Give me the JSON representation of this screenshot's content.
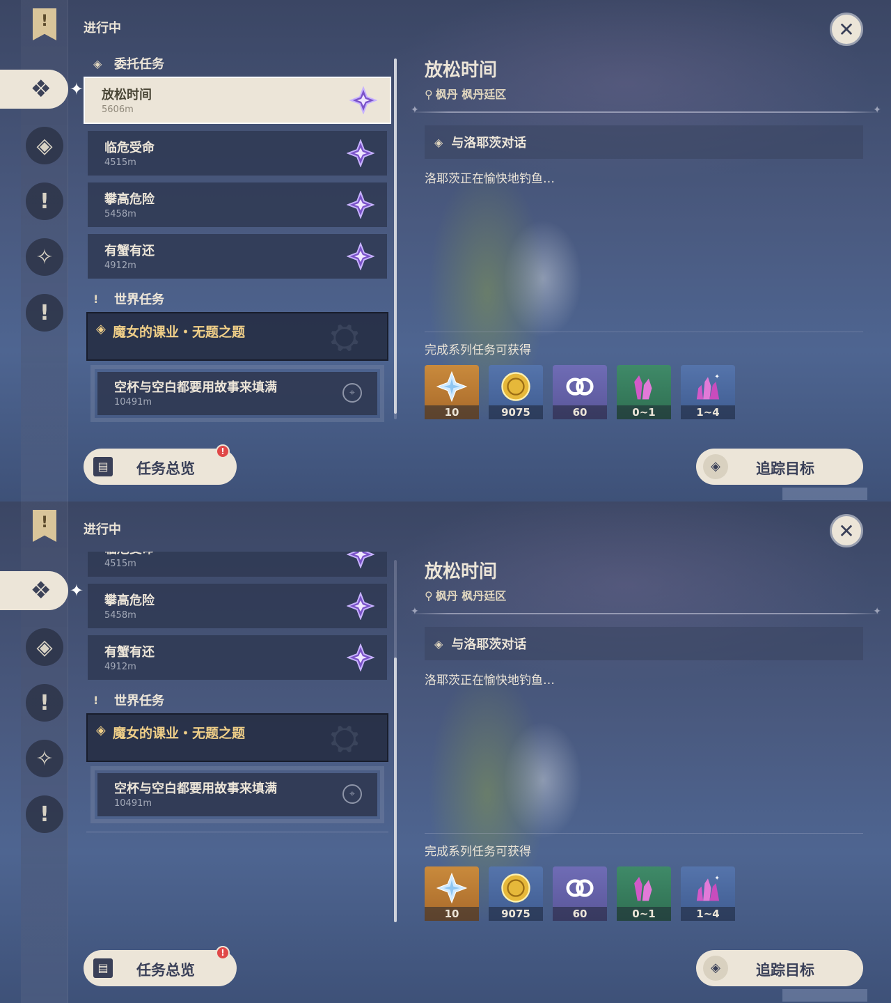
{
  "header": {
    "section_label": "进行中",
    "close_icon": "close-icon"
  },
  "rail": {
    "bookmark_glyph": "!",
    "active_icon": "commission-icon",
    "icons": [
      "archon-quest-icon",
      "story-quest-icon",
      "domain-quest-icon",
      "world-quest-icon"
    ]
  },
  "list": {
    "commission_group": "委托任务",
    "world_group": "世界任务",
    "quests": [
      {
        "title": "放松时间",
        "distance": "5606m"
      },
      {
        "title": "临危受命",
        "distance": "4515m"
      },
      {
        "title": "攀高危险",
        "distance": "5458m"
      },
      {
        "title": "有蟹有还",
        "distance": "4912m"
      }
    ],
    "world_quest": {
      "title": "魔女的课业・无题之题",
      "sub_title": "空杯与空白都要用故事来填满",
      "sub_distance": "10491m"
    }
  },
  "detail": {
    "title": "放松时间",
    "location": "枫丹 枫丹廷区",
    "objective": "与洛耶茨对话",
    "description": "洛耶茨正在愉快地钓鱼…",
    "rewards_label": "完成系列任务可获得",
    "rewards": [
      {
        "name": "primogem-icon",
        "qty": "10",
        "bg": "#c98a3c"
      },
      {
        "name": "mora-icon",
        "qty": "9075",
        "bg": "#4b6aa0"
      },
      {
        "name": "friendship-exp-icon",
        "qty": "60",
        "bg": "#6f6cb5"
      },
      {
        "name": "purple-crystal-icon",
        "qty": "0~1",
        "bg": "#3f8a68"
      },
      {
        "name": "crystal-cluster-icon",
        "qty": "1~4",
        "bg": "#4b6aa0"
      }
    ]
  },
  "buttons": {
    "overview": "任务总览",
    "overview_badge": "!",
    "track": "追踪目标"
  }
}
